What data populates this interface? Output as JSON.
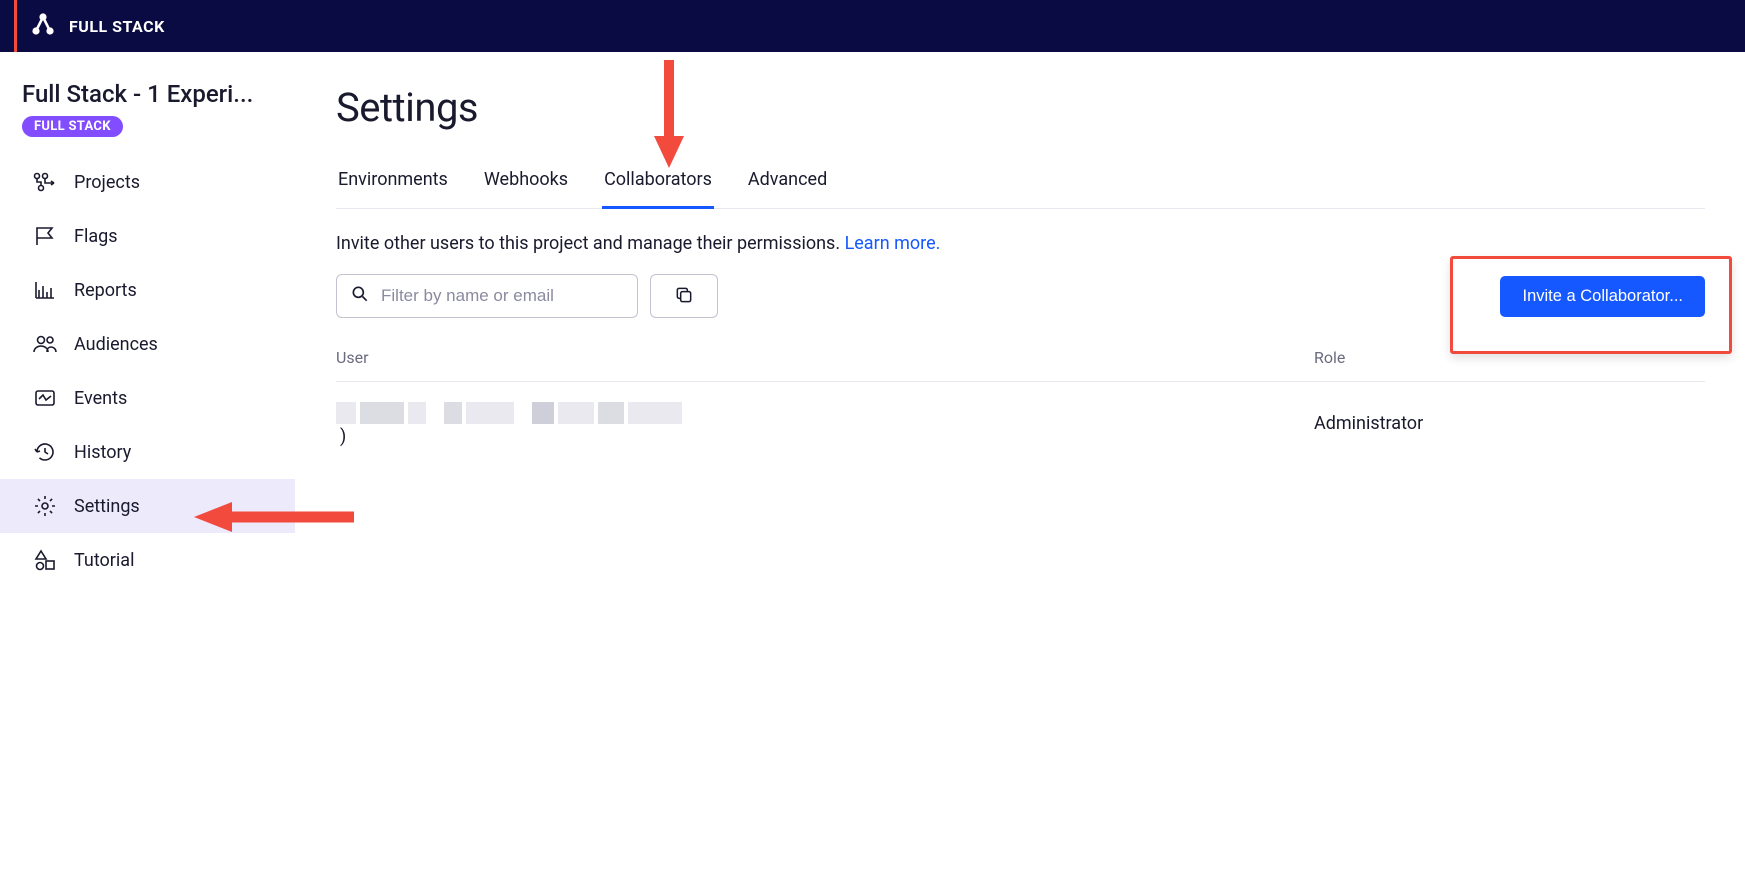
{
  "brand": "FULL STACK",
  "sidebar": {
    "project_title": "Full Stack - 1 Experi...",
    "badge": "FULL STACK",
    "items": [
      {
        "label": "Projects"
      },
      {
        "label": "Flags"
      },
      {
        "label": "Reports"
      },
      {
        "label": "Audiences"
      },
      {
        "label": "Events"
      },
      {
        "label": "History"
      },
      {
        "label": "Settings"
      },
      {
        "label": "Tutorial"
      }
    ]
  },
  "page": {
    "title": "Settings",
    "tabs": {
      "environments": "Environments",
      "webhooks": "Webhooks",
      "collaborators": "Collaborators",
      "advanced": "Advanced"
    },
    "description_prefix": "Invite other users to this project and manage their permissions. ",
    "learn_more": "Learn more",
    "filter_placeholder": "Filter by name or email",
    "invite_label": "Invite a Collaborator...",
    "columns": {
      "user": "User",
      "role": "Role"
    },
    "row1": {
      "user_suffix": ")",
      "role": "Administrator"
    }
  }
}
